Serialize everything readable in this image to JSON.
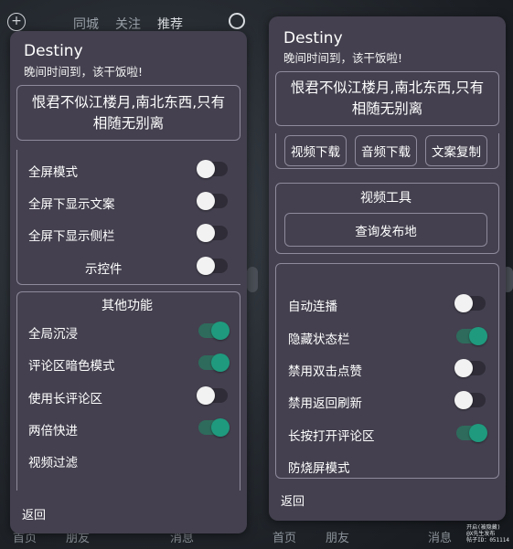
{
  "background": {
    "tabs": [
      "同城",
      "关注",
      "推荐"
    ],
    "nav_left": [
      "首页",
      "朋友",
      "消息"
    ],
    "nav_right": [
      "首页",
      "朋友",
      "消息"
    ]
  },
  "left_panel": {
    "title": "Destiny",
    "subtitle": "晚间时间到，该干饭啦!",
    "quote": "恨君不似江楼月,南北东西,只有相随无别离",
    "toggles": [
      {
        "label": "全屏模式",
        "on": false
      },
      {
        "label": "全屏下显示文案",
        "on": false
      },
      {
        "label": "全屏下显示侧栏",
        "on": false
      },
      {
        "label": "示控件",
        "on": false
      }
    ],
    "section_title": "其他功能",
    "more_toggles": [
      {
        "label": "全局沉浸",
        "on": true
      },
      {
        "label": "评论区暗色模式",
        "on": true
      },
      {
        "label": "使用长评论区",
        "on": false
      },
      {
        "label": "两倍快进",
        "on": true
      }
    ],
    "video_filter": "视频过滤",
    "back": "返回"
  },
  "right_panel": {
    "title": "Destiny",
    "subtitle": "晚间时间到，该干饭啦!",
    "quote": "恨君不似江楼月,南北东西,只有相随无别离",
    "buttons": [
      "视频下载",
      "音频下载",
      "文案复制"
    ],
    "tools_title": "视频工具",
    "query_button": "查询发布地",
    "toggles": [
      {
        "label": "自动连播",
        "on": false
      },
      {
        "label": "隐藏状态栏",
        "on": true
      },
      {
        "label": "禁用双击点赞",
        "on": false
      },
      {
        "label": "禁用返回刷新",
        "on": false
      },
      {
        "label": "长按打开评论区",
        "on": true
      }
    ],
    "anti_burn": "防烧屏模式",
    "back": "返回"
  },
  "watermark": [
    "开启(被隐藏)",
    "@X先生发布",
    "帖子ID：051114"
  ]
}
